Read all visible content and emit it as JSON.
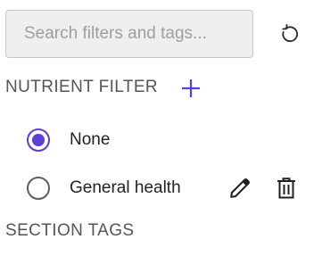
{
  "search": {
    "placeholder": "Search filters and tags...",
    "value": ""
  },
  "reset": {
    "icon": "refresh-icon"
  },
  "nutrient_filter": {
    "title": "NUTRIENT FILTER",
    "add_icon": "plus-icon",
    "options": [
      {
        "label": "None",
        "selected": true
      },
      {
        "label": "General health",
        "selected": false,
        "actions": [
          "pencil-icon",
          "trash-icon"
        ]
      }
    ]
  },
  "section_tags": {
    "title": "SECTION TAGS"
  },
  "colors": {
    "accent": "#5b3fd6",
    "text": "#222222",
    "muted": "#555555"
  }
}
